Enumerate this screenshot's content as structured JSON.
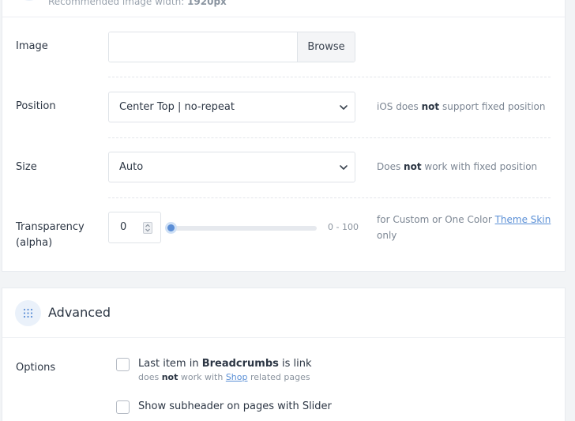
{
  "previous_section": {
    "hint_prefix": "Recommended image width: ",
    "hint_value": "1920px"
  },
  "background_image": {
    "image": {
      "label": "Image",
      "value": "",
      "browse_label": "Browse"
    },
    "position": {
      "label": "Position",
      "selected": "Center Top | no-repeat",
      "hint_pre": "iOS does ",
      "hint_bold": "not",
      "hint_post": " support fixed position"
    },
    "size": {
      "label": "Size",
      "selected": "Auto",
      "hint_pre": "Does ",
      "hint_bold": "not",
      "hint_post": " work with fixed position"
    },
    "transparency": {
      "label_line1": "Transparency",
      "label_line2": "(alpha)",
      "value": "0",
      "slider_value": 0,
      "range_label": "0 - 100",
      "hint_pre": "for Custom or One Color ",
      "hint_link": "Theme Skin",
      "hint_line2": "only"
    }
  },
  "advanced": {
    "title": "Advanced",
    "options_label": "Options",
    "options": [
      {
        "pre": "Last item in ",
        "bold": "Breadcrumbs",
        "post": " is link",
        "checked": false,
        "sub_pre": "does ",
        "sub_bold": "not",
        "sub_mid": " work with ",
        "sub_link": "Shop",
        "sub_post": " related pages"
      },
      {
        "label": "Show subheader on pages with Slider",
        "checked": false
      }
    ]
  },
  "colors": {
    "accent": "#5b8ed6",
    "link": "#5a8fd6",
    "page_bg": "#f2f4f6",
    "card_bg": "#ffffff"
  },
  "icons": {
    "select_arrow": "chevron-down-icon",
    "section_icon": "dots-grid-icon",
    "spinner": "spinner-arrows-icon"
  }
}
